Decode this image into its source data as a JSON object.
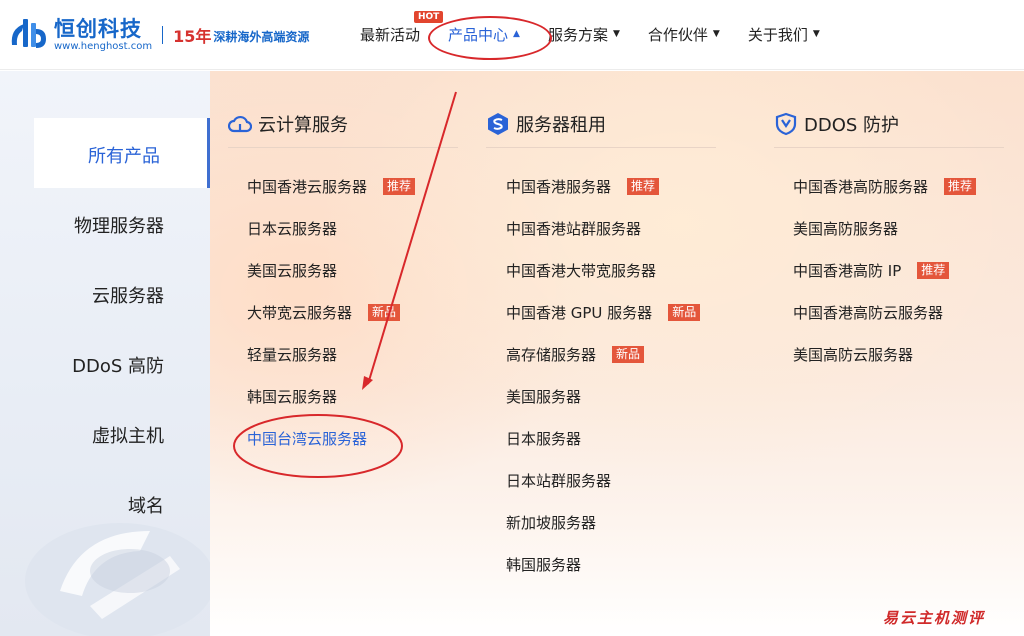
{
  "brand": {
    "name": "恒创科技",
    "url": "www.henghost.com",
    "years": "15年",
    "slogan": "深耕海外高端资源",
    "color": "#1767c9"
  },
  "nav": {
    "items": [
      {
        "label": "最新活动",
        "badge": "HOT"
      },
      {
        "label": "产品中心"
      },
      {
        "label": "服务方案"
      },
      {
        "label": "合作伙伴"
      },
      {
        "label": "关于我们"
      }
    ]
  },
  "sidebar": {
    "items": [
      "所有产品",
      "物理服务器",
      "云服务器",
      "DDoS 高防",
      "虚拟主机",
      "域名"
    ]
  },
  "columns": {
    "cloud": {
      "title": "云计算服务",
      "items": [
        {
          "label": "中国香港云服务器",
          "tag": "推荐"
        },
        {
          "label": "日本云服务器"
        },
        {
          "label": "美国云服务器"
        },
        {
          "label": "大带宽云服务器",
          "tag": "新品"
        },
        {
          "label": "轻量云服务器"
        },
        {
          "label": "韩国云服务器"
        },
        {
          "label": "中国台湾云服务器"
        }
      ]
    },
    "server": {
      "title": "服务器租用",
      "items": [
        {
          "label": "中国香港服务器",
          "tag": "推荐"
        },
        {
          "label": "中国香港站群服务器"
        },
        {
          "label": "中国香港大带宽服务器"
        },
        {
          "label": "中国香港 GPU 服务器",
          "tag": "新品"
        },
        {
          "label": "高存储服务器",
          "tag": "新品"
        },
        {
          "label": "美国服务器"
        },
        {
          "label": "日本服务器"
        },
        {
          "label": "日本站群服务器"
        },
        {
          "label": "新加坡服务器"
        },
        {
          "label": "韩国服务器"
        }
      ]
    },
    "ddos": {
      "title": "DDOS 防护",
      "items": [
        {
          "label": "中国香港高防服务器",
          "tag": "推荐"
        },
        {
          "label": "美国高防服务器"
        },
        {
          "label": "中国香港高防 IP",
          "tag": "推荐"
        },
        {
          "label": "中国香港高防云服务器"
        },
        {
          "label": "美国高防云服务器"
        }
      ]
    }
  },
  "watermark": "易云主机测评",
  "colors": {
    "accent": "#2a63d7",
    "tag_bg": "#e4563b",
    "annotation": "#d8282b"
  }
}
